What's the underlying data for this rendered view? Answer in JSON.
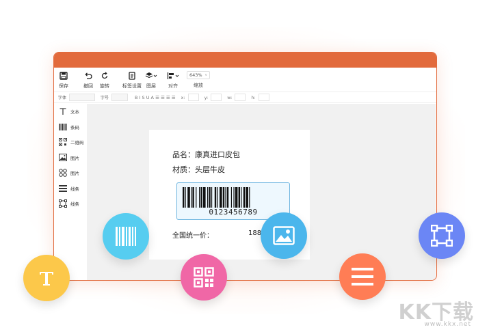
{
  "toolbar": {
    "save": "保存",
    "undo": "撤回",
    "rotate": "旋转",
    "label_settings": "标签设置",
    "layers": "图层",
    "align": "对齐",
    "zoom_value": "643%",
    "zoom_label": "缩放"
  },
  "format_bar": {
    "font_label": "字体",
    "size_label": "字号",
    "styles": "B I S U A ☰ ☰ ☰ ☰",
    "x_label": "x:",
    "y_label": "y:",
    "w_label": "w:",
    "h_label": "h:"
  },
  "sidebar": {
    "items": [
      {
        "label": "文本",
        "icon": "text-icon"
      },
      {
        "label": "条码",
        "icon": "barcode-icon"
      },
      {
        "label": "二维码",
        "icon": "qrcode-icon"
      },
      {
        "label": "图片",
        "icon": "image-icon"
      },
      {
        "label": "图片",
        "icon": "shapes-icon"
      },
      {
        "label": "线条",
        "icon": "lines-icon"
      },
      {
        "label": "线条",
        "icon": "rectangle-icon"
      }
    ]
  },
  "label_preview": {
    "product_name": "品名：康真进口皮包",
    "material": "材质：头层牛皮",
    "barcode_number": "0123456789",
    "price_label": "全国统一价：",
    "price_value": "188"
  },
  "colors": {
    "accent": "#e26a3c",
    "text_circle": "#fcc84a",
    "barcode_circle": "#56cdf0",
    "qrcode_circle": "#f067a6",
    "image_circle": "#4bb6ec",
    "lines_circle": "#ff7d55",
    "shape_circle": "#6b86f5"
  },
  "watermark": {
    "brand": "KK下载",
    "url": "www.kkx.net"
  }
}
